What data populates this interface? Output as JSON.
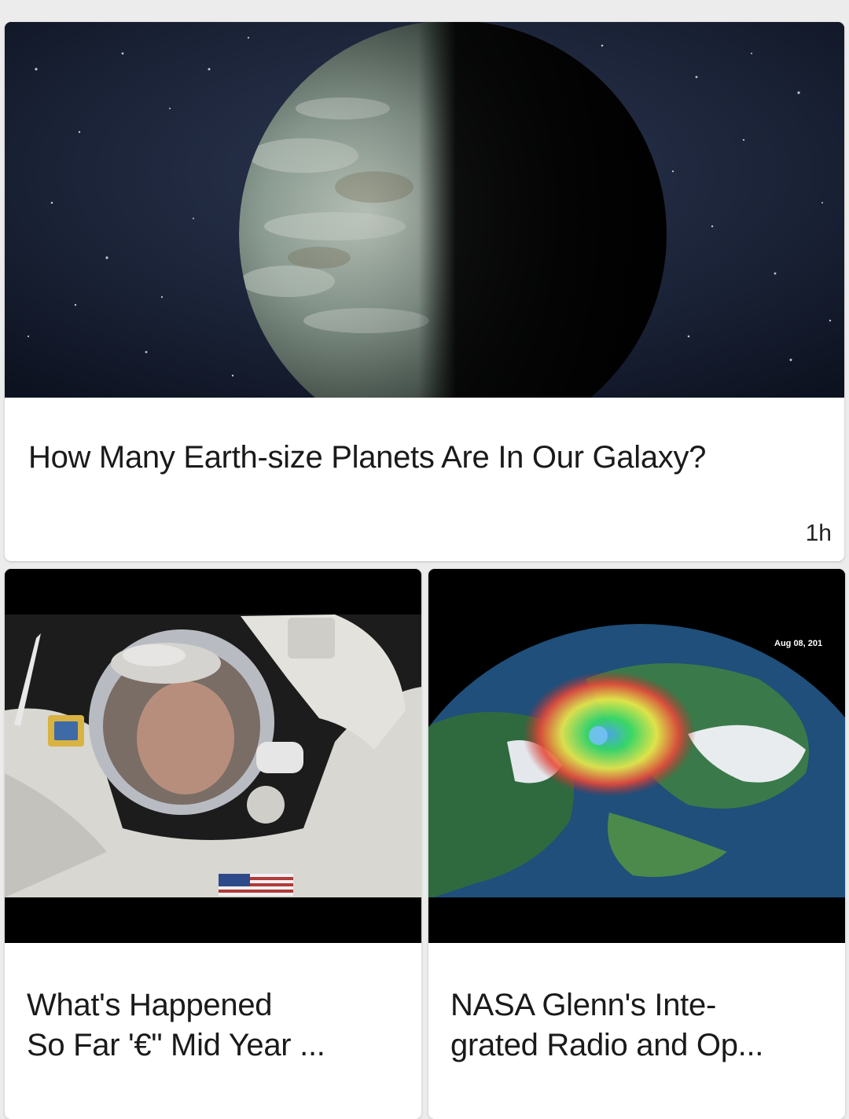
{
  "feed": {
    "featured": {
      "title": "How Many Earth-size Planets Are In Our Galaxy?",
      "time": "1h",
      "image_icon": "planet-image"
    },
    "items": [
      {
        "title_line1": "What's Happened",
        "title_line2": "So Far '€\" Mid Year ...",
        "image_icon": "astronaut-image"
      },
      {
        "title_line1": "NASA Glenn's Inte-",
        "title_line2": "grated Radio and Op...",
        "image_icon": "earth-hurricane-image",
        "image_caption": "Aug 08, 201"
      }
    ]
  },
  "colors": {
    "background": "#ececec",
    "card": "#ffffff",
    "text": "#1a1a1a"
  }
}
